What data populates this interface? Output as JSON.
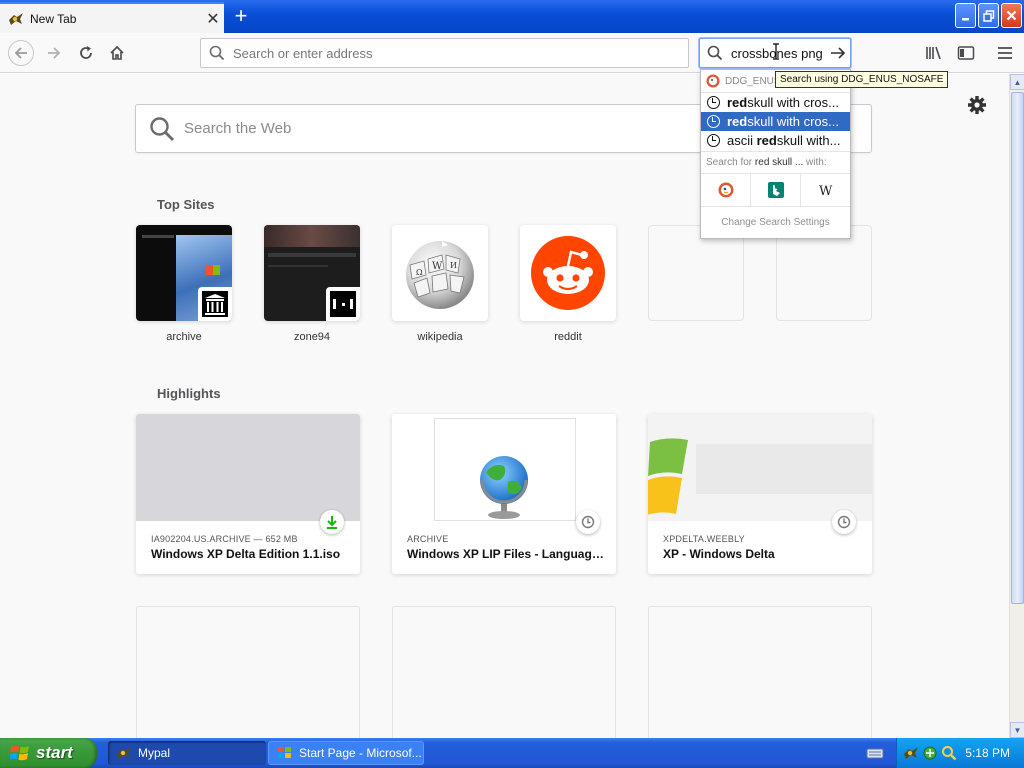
{
  "browser": {
    "tab_title": "New Tab",
    "new_tab_symbol": "+",
    "close_symbol": "✕",
    "url_placeholder": "Search or enter address",
    "search_value": "crossbones png",
    "tooltip": "Search using DDG_ENUS_NOSAFE"
  },
  "newtab": {
    "web_search_placeholder": "Search the Web",
    "top_sites_title": "Top Sites",
    "top_sites": [
      {
        "label": "archive"
      },
      {
        "label": "zone94"
      },
      {
        "label": "wikipedia"
      },
      {
        "label": "reddit"
      }
    ],
    "highlights_title": "Highlights",
    "highlights": [
      {
        "source": "IA902204.US.ARCHIVE — 652 MB",
        "title": "Windows XP Delta Edition 1.1.iso",
        "badge": "download-icon"
      },
      {
        "source": "ARCHIVE",
        "title": "Windows XP LIP Files - Language...",
        "badge": "history-icon"
      },
      {
        "source": "XPDELTA.WEEBLY",
        "title": "XP - Windows Delta",
        "badge": "history-icon"
      }
    ]
  },
  "popup": {
    "engine_header": "DDG_ENUS_NOSAFE",
    "suggestions": [
      {
        "bold": "red",
        "rest": " skull with cros..."
      },
      {
        "bold": "red",
        "rest": " skull with cros..."
      },
      {
        "pre": "ascii ",
        "bold": "red",
        "rest": " skull with..."
      }
    ],
    "search_for_prefix": "Search for ",
    "search_for_query": "red skull ...",
    "search_for_suffix": " with:",
    "engines": [
      "DuckDuckGo",
      "Bing",
      "Wikipedia"
    ],
    "settings_label": "Change Search Settings"
  },
  "taskbar": {
    "start_label": "start",
    "tasks": [
      {
        "label": "Mypal"
      },
      {
        "label": "Start Page - Microsof..."
      }
    ],
    "time": "5:18 PM"
  },
  "colors": {
    "taskbar_blue": "#245edb",
    "start_green": "#3a9b3a",
    "selection_blue": "#316ac5",
    "reddit_orange": "#ff4500",
    "download_green": "#12bc00"
  }
}
